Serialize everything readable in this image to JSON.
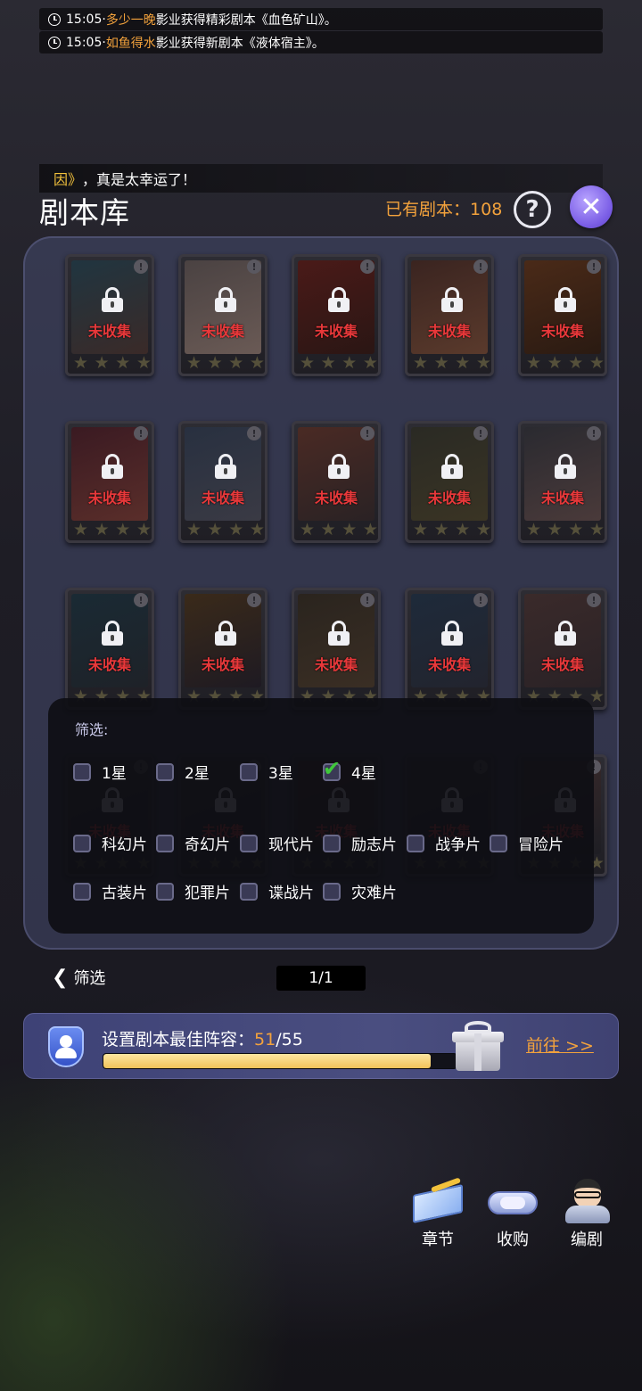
{
  "ticker": [
    {
      "time": "15:05",
      "sep": " · ",
      "name": "多少一晚",
      "text": "影业获得精彩剧本《血色矿山》。"
    },
    {
      "time": "15:05",
      "sep": " · ",
      "name": "如鱼得水",
      "text": "影业获得新剧本《液体宿主》。"
    }
  ],
  "lucky_banner": {
    "highlight": "因》",
    "text": "，真是太幸运了！"
  },
  "header": {
    "title": "剧本库",
    "owned_label": "已有剧本：",
    "owned_count": "108",
    "help_label": "?",
    "close_label": "✕"
  },
  "cards": {
    "status_label": "未收集",
    "info_label": "!",
    "star": "★",
    "posters": [
      {
        "c1": "#203540",
        "c2": "#3a2a28"
      },
      {
        "c1": "#4a4242",
        "c2": "#6a5a55"
      },
      {
        "c1": "#4a1a18",
        "c2": "#2a1614"
      },
      {
        "c1": "#3a2420",
        "c2": "#5a3a2c"
      },
      {
        "c1": "#4a2a18",
        "c2": "#2a1a12"
      },
      {
        "c1": "#3a1a22",
        "c2": "#5a2e2a"
      },
      {
        "c1": "#283040",
        "c2": "#3a3a44"
      },
      {
        "c1": "#4a2a24",
        "c2": "#2a2224"
      },
      {
        "c1": "#2a2a24",
        "c2": "#3a3424"
      },
      {
        "c1": "#2a2a30",
        "c2": "#4a3a3a"
      },
      {
        "c1": "#1a2a34",
        "c2": "#1e2228"
      },
      {
        "c1": "#3a2a1a",
        "c2": "#1e1a22"
      },
      {
        "c1": "#2a241e",
        "c2": "#3a2e24"
      },
      {
        "c1": "#1e2a3a",
        "c2": "#22242e"
      },
      {
        "c1": "#3a2a2a",
        "c2": "#2a2226"
      },
      {
        "c1": "#2a2a30",
        "c2": "#1e1e24"
      },
      {
        "c1": "#2a2a30",
        "c2": "#1e1e24"
      },
      {
        "c1": "#3a2420",
        "c2": "#1e1e24"
      },
      {
        "c1": "#2a2a30",
        "c2": "#1e1e24"
      },
      {
        "c1": "#3a2a2a",
        "c2": "#1e1e24"
      }
    ]
  },
  "filter": {
    "label": "筛选:",
    "stars": [
      {
        "label": "1星",
        "checked": false
      },
      {
        "label": "2星",
        "checked": false
      },
      {
        "label": "3星",
        "checked": false
      },
      {
        "label": "4星",
        "checked": true
      }
    ],
    "genres_row1": [
      "科幻片",
      "奇幻片",
      "现代片",
      "励志片",
      "战争片",
      "冒险片"
    ],
    "genres_row2": [
      "古装片",
      "犯罪片",
      "谍战片",
      "灾难片"
    ]
  },
  "filter_toggle": {
    "label": "筛选"
  },
  "pager": {
    "text": "1/1"
  },
  "lineup": {
    "label": "设置剧本最佳阵容：",
    "current": "51",
    "total": "/55",
    "progress": 0.927,
    "goto_label": "前往 >>"
  },
  "actions": [
    {
      "label": "章节",
      "icon": "book-icon"
    },
    {
      "label": "收购",
      "icon": "handshake-icon"
    },
    {
      "label": "编剧",
      "icon": "writer-icon"
    }
  ]
}
